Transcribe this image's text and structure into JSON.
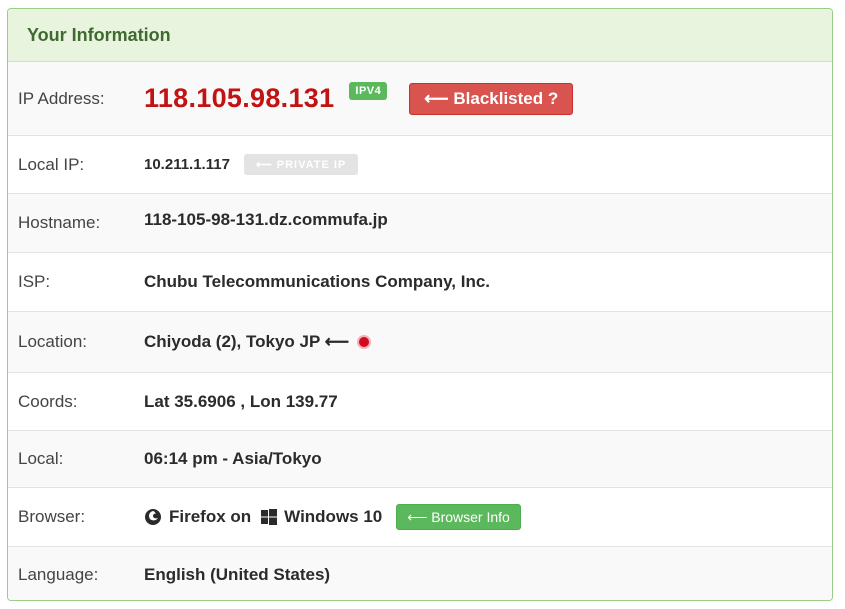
{
  "panel": {
    "title": "Your Information"
  },
  "rows": {
    "ip": {
      "label": "IP Address:",
      "value": "118.105.98.131",
      "badge": "IPV4",
      "button": "⟵ Blacklisted ?"
    },
    "local_ip": {
      "label": "Local IP:",
      "value": "10.211.1.117",
      "badge": "⟵ PRIVATE IP"
    },
    "hostname": {
      "label": "Hostname:",
      "value": "118-105-98-131.dz.commufa.jp"
    },
    "isp": {
      "label": "ISP:",
      "value": "Chubu Telecommunications Company, Inc."
    },
    "location": {
      "label": "Location:",
      "value": "Chiyoda (2), Tokyo JP ⟵"
    },
    "coords": {
      "label": "Coords:",
      "value": "Lat 35.6906 , Lon 139.77"
    },
    "local": {
      "label": "Local:",
      "value": "06:14 pm - Asia/Tokyo"
    },
    "browser": {
      "label": "Browser:",
      "browser": "Firefox on",
      "os": "Windows 10",
      "button": "⟵ Browser Info"
    },
    "language": {
      "label": "Language:",
      "value": "English (United States)"
    }
  },
  "colors": {
    "accent": "#5cb85c",
    "danger": "#d9534f",
    "ip": "#c11313",
    "header_bg": "#e9f4df"
  },
  "icons": {
    "browser": "firefox-icon",
    "os": "windows-icon",
    "flag": "japan-flag-icon"
  }
}
